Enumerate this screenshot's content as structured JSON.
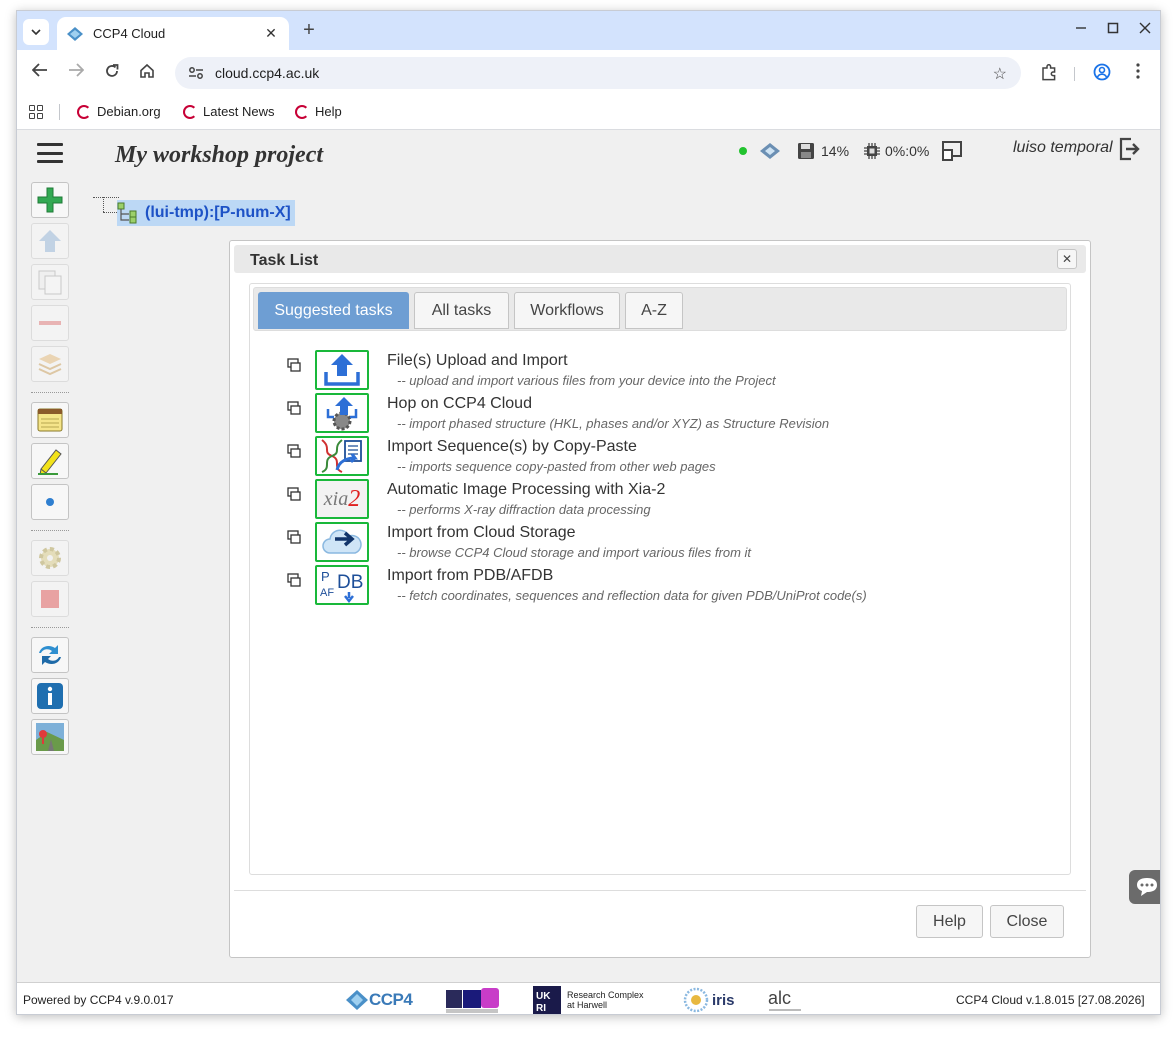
{
  "browser": {
    "tab_title": "CCP4 Cloud",
    "url": "cloud.ccp4.ac.uk",
    "bookmarks": [
      {
        "label": "Debian.org"
      },
      {
        "label": "Latest News"
      },
      {
        "label": "Help"
      }
    ]
  },
  "app": {
    "project_title": "My workshop project",
    "disk_usage": "14%",
    "cpu_usage": "0%:0%",
    "user_name": "luiso temporal",
    "tree_root_label": "(lui-tmp):[P-num-X]"
  },
  "dialog": {
    "title": "Task List",
    "tabs": [
      {
        "label": "Suggested tasks",
        "active": true
      },
      {
        "label": "All tasks",
        "active": false
      },
      {
        "label": "Workflows",
        "active": false
      },
      {
        "label": "A-Z",
        "active": false
      }
    ],
    "tasks": [
      {
        "icon": "upload-import-icon",
        "title": "File(s) Upload and Import",
        "desc": "-- upload and import various files from your device into the Project"
      },
      {
        "icon": "ccp4-cloud-hop-icon",
        "title": "Hop on CCP4 Cloud",
        "desc": "-- import phased structure (HKL, phases and/or XYZ) as Structure Revision"
      },
      {
        "icon": "sequence-import-icon",
        "title": "Import Sequence(s) by Copy-Paste",
        "desc": "-- imports sequence copy-pasted from other web pages"
      },
      {
        "icon": "xia2-icon",
        "icon_text": "xia2",
        "title": "Automatic Image Processing with Xia-2",
        "desc": "-- performs X-ray diffraction data processing"
      },
      {
        "icon": "cloud-storage-icon",
        "title": "Import from Cloud Storage",
        "desc": "-- browse CCP4 Cloud storage and import various files from it"
      },
      {
        "icon": "pdb-afdb-icon",
        "icon_text": "PDB AF",
        "title": "Import from PDB/AFDB",
        "desc": "-- fetch coordinates, sequences and reflection data for given PDB/UniProt code(s)"
      }
    ],
    "help_label": "Help",
    "close_label": "Close"
  },
  "footer": {
    "left": "Powered by CCP4 v.9.0.017",
    "right": "CCP4 Cloud v.1.8.015 [27.08.2026]",
    "logos": {
      "ccp4": "CCP4",
      "rch": "Research Complex at Harwell",
      "iris": "iris"
    }
  },
  "colors": {
    "tabstrip": "#d3e3fd",
    "active_tab": "#6e9ed3",
    "task_icon_border": "#19b83a",
    "tree_label": "#1d52c6",
    "tree_highlight": "#bcd8f5"
  }
}
